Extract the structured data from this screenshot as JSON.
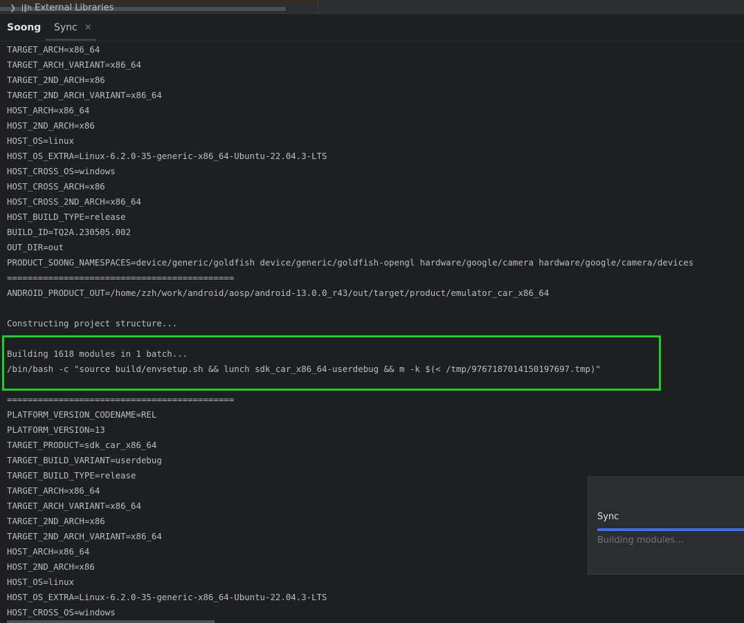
{
  "project_tree": {
    "item_label": "External Libraries",
    "expand_icon": "chevron-right-icon",
    "library_icon": "library-icon"
  },
  "tabs": {
    "soong_label": "Soong",
    "sync_label": "Sync",
    "close_glyph": "×"
  },
  "console_lines": [
    "TARGET_ARCH=x86_64",
    "TARGET_ARCH_VARIANT=x86_64",
    "TARGET_2ND_ARCH=x86",
    "TARGET_2ND_ARCH_VARIANT=x86_64",
    "HOST_ARCH=x86_64",
    "HOST_2ND_ARCH=x86",
    "HOST_OS=linux",
    "HOST_OS_EXTRA=Linux-6.2.0-35-generic-x86_64-Ubuntu-22.04.3-LTS",
    "HOST_CROSS_OS=windows",
    "HOST_CROSS_ARCH=x86",
    "HOST_CROSS_2ND_ARCH=x86_64",
    "HOST_BUILD_TYPE=release",
    "BUILD_ID=TQ2A.230505.002",
    "OUT_DIR=out",
    "PRODUCT_SOONG_NAMESPACES=device/generic/goldfish device/generic/goldfish-opengl hardware/google/camera hardware/google/camera/devices",
    "============================================",
    "ANDROID_PRODUCT_OUT=/home/zzh/work/android/aosp/android-13.0.0_r43/out/target/product/emulator_car_x86_64",
    "",
    "Constructing project structure...",
    "",
    "Building 1618 modules in 1 batch...",
    "/bin/bash -c \"source build/envsetup.sh && lunch sdk_car_x86_64-userdebug && m -k $(< /tmp/9767187014150197697.tmp)\"",
    "",
    "============================================",
    "PLATFORM_VERSION_CODENAME=REL",
    "PLATFORM_VERSION=13",
    "TARGET_PRODUCT=sdk_car_x86_64",
    "TARGET_BUILD_VARIANT=userdebug",
    "TARGET_BUILD_TYPE=release",
    "TARGET_ARCH=x86_64",
    "TARGET_ARCH_VARIANT=x86_64",
    "TARGET_2ND_ARCH=x86",
    "TARGET_2ND_ARCH_VARIANT=x86_64",
    "HOST_ARCH=x86_64",
    "HOST_2ND_ARCH=x86",
    "HOST_OS=linux",
    "HOST_OS_EXTRA=Linux-6.2.0-35-generic-x86_64-Ubuntu-22.04.3-LTS",
    "HOST_CROSS_OS=windows"
  ],
  "highlight_color": "#1ed31e",
  "sync_popup": {
    "title": "Sync",
    "status": "Building modules...",
    "progress_color": "#3574f0"
  }
}
